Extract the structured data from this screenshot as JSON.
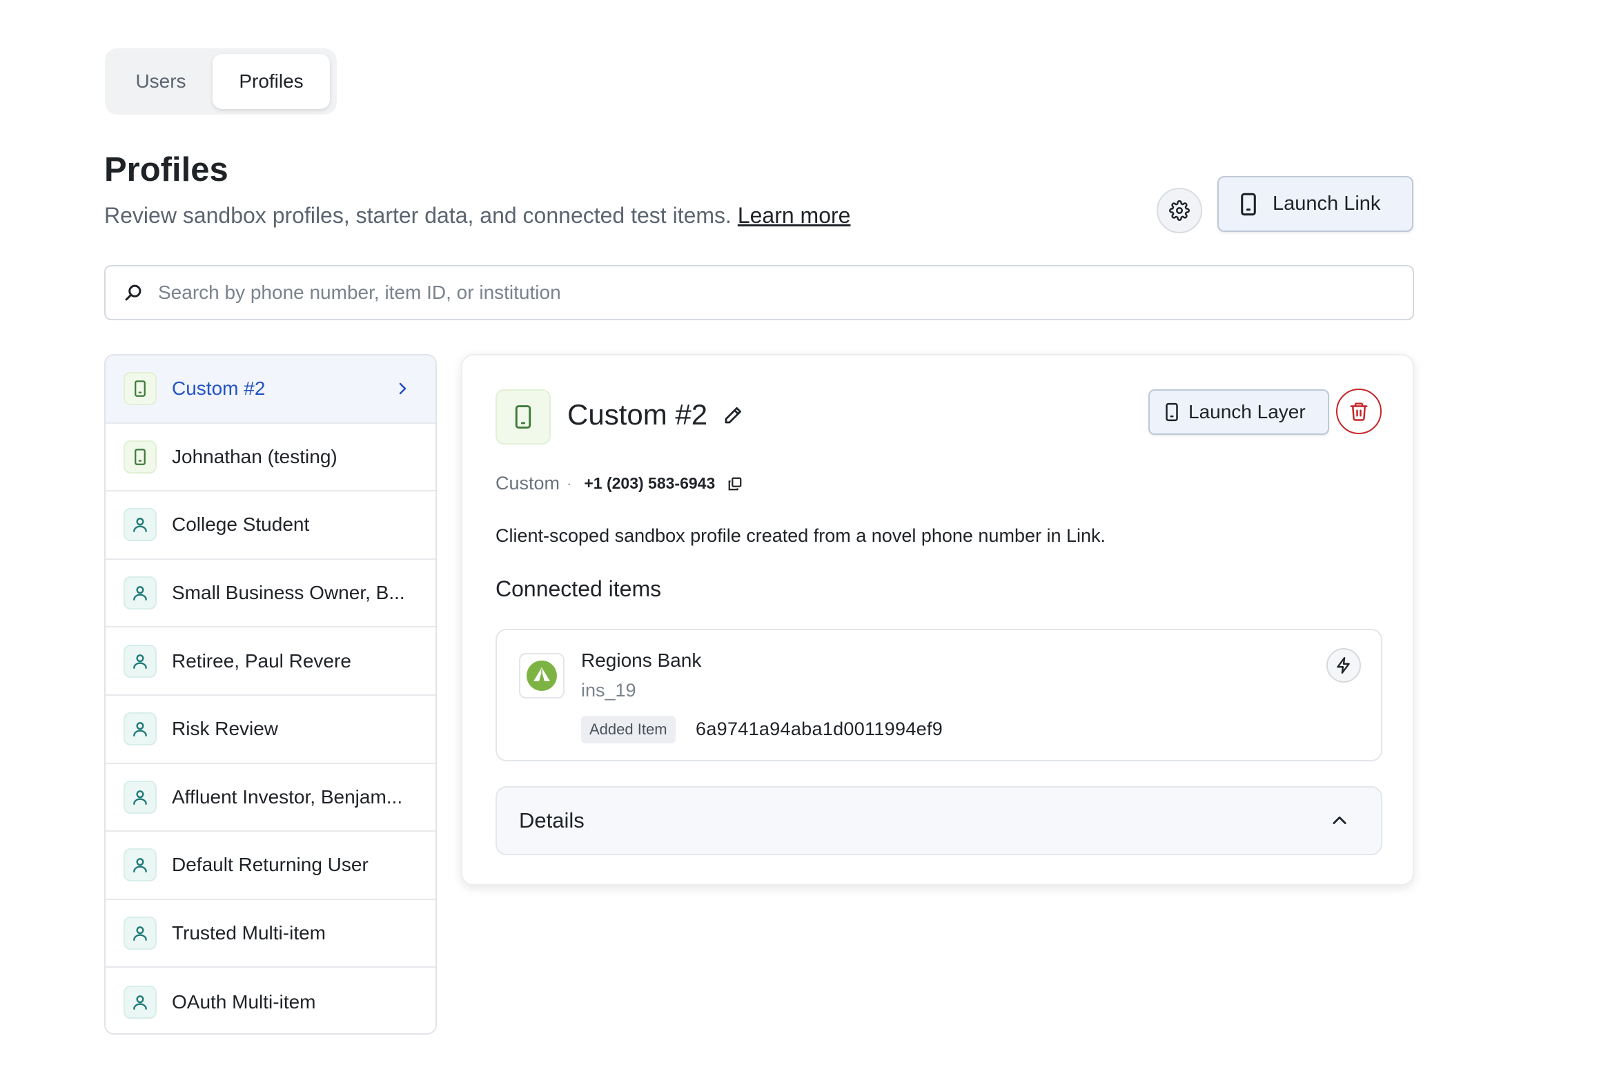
{
  "tabs": [
    {
      "label": "Users"
    },
    {
      "label": "Profiles",
      "active": true
    }
  ],
  "header": {
    "title": "Profiles",
    "subtitle": "Review sandbox profiles, starter data, and connected test items.",
    "learn_more": "Learn more",
    "launch_link_label": "Launch Link"
  },
  "search": {
    "placeholder": "Search by phone number, item ID, or institution",
    "value": ""
  },
  "profiles": [
    {
      "label": "Custom #2",
      "icon": "phone-icon",
      "active": true
    },
    {
      "label": "Johnathan (testing)",
      "icon": "phone-icon"
    },
    {
      "label": "College Student",
      "icon": "person-icon"
    },
    {
      "label": "Small Business Owner, B...",
      "icon": "person-icon"
    },
    {
      "label": "Retiree, Paul Revere",
      "icon": "person-icon"
    },
    {
      "label": "Risk Review",
      "icon": "person-icon"
    },
    {
      "label": "Affluent Investor, Benjam...",
      "icon": "person-icon"
    },
    {
      "label": "Default Returning User",
      "icon": "person-icon"
    },
    {
      "label": "Trusted Multi-item",
      "icon": "person-icon"
    },
    {
      "label": "OAuth Multi-item",
      "icon": "person-icon"
    }
  ],
  "detail": {
    "title": "Custom #2",
    "launch_layer_label": "Launch Layer",
    "type": "Custom",
    "separator": "·",
    "phone": "+1 (203) 583-6943",
    "description": "Client-scoped sandbox profile created from a novel phone number in Link.",
    "connected_heading": "Connected items",
    "item": {
      "bank_name": "Regions Bank",
      "institution_id": "ins_19",
      "badge": "Added Item",
      "item_id": "6a9741a94aba1d0011994ef9"
    },
    "details_label": "Details"
  },
  "colors": {
    "accent": "#2353c4",
    "danger": "#c5272b",
    "phone_icon": "#3f7a3a",
    "person_icon": "#1f7a78",
    "bank_logo": "#7cb342"
  }
}
